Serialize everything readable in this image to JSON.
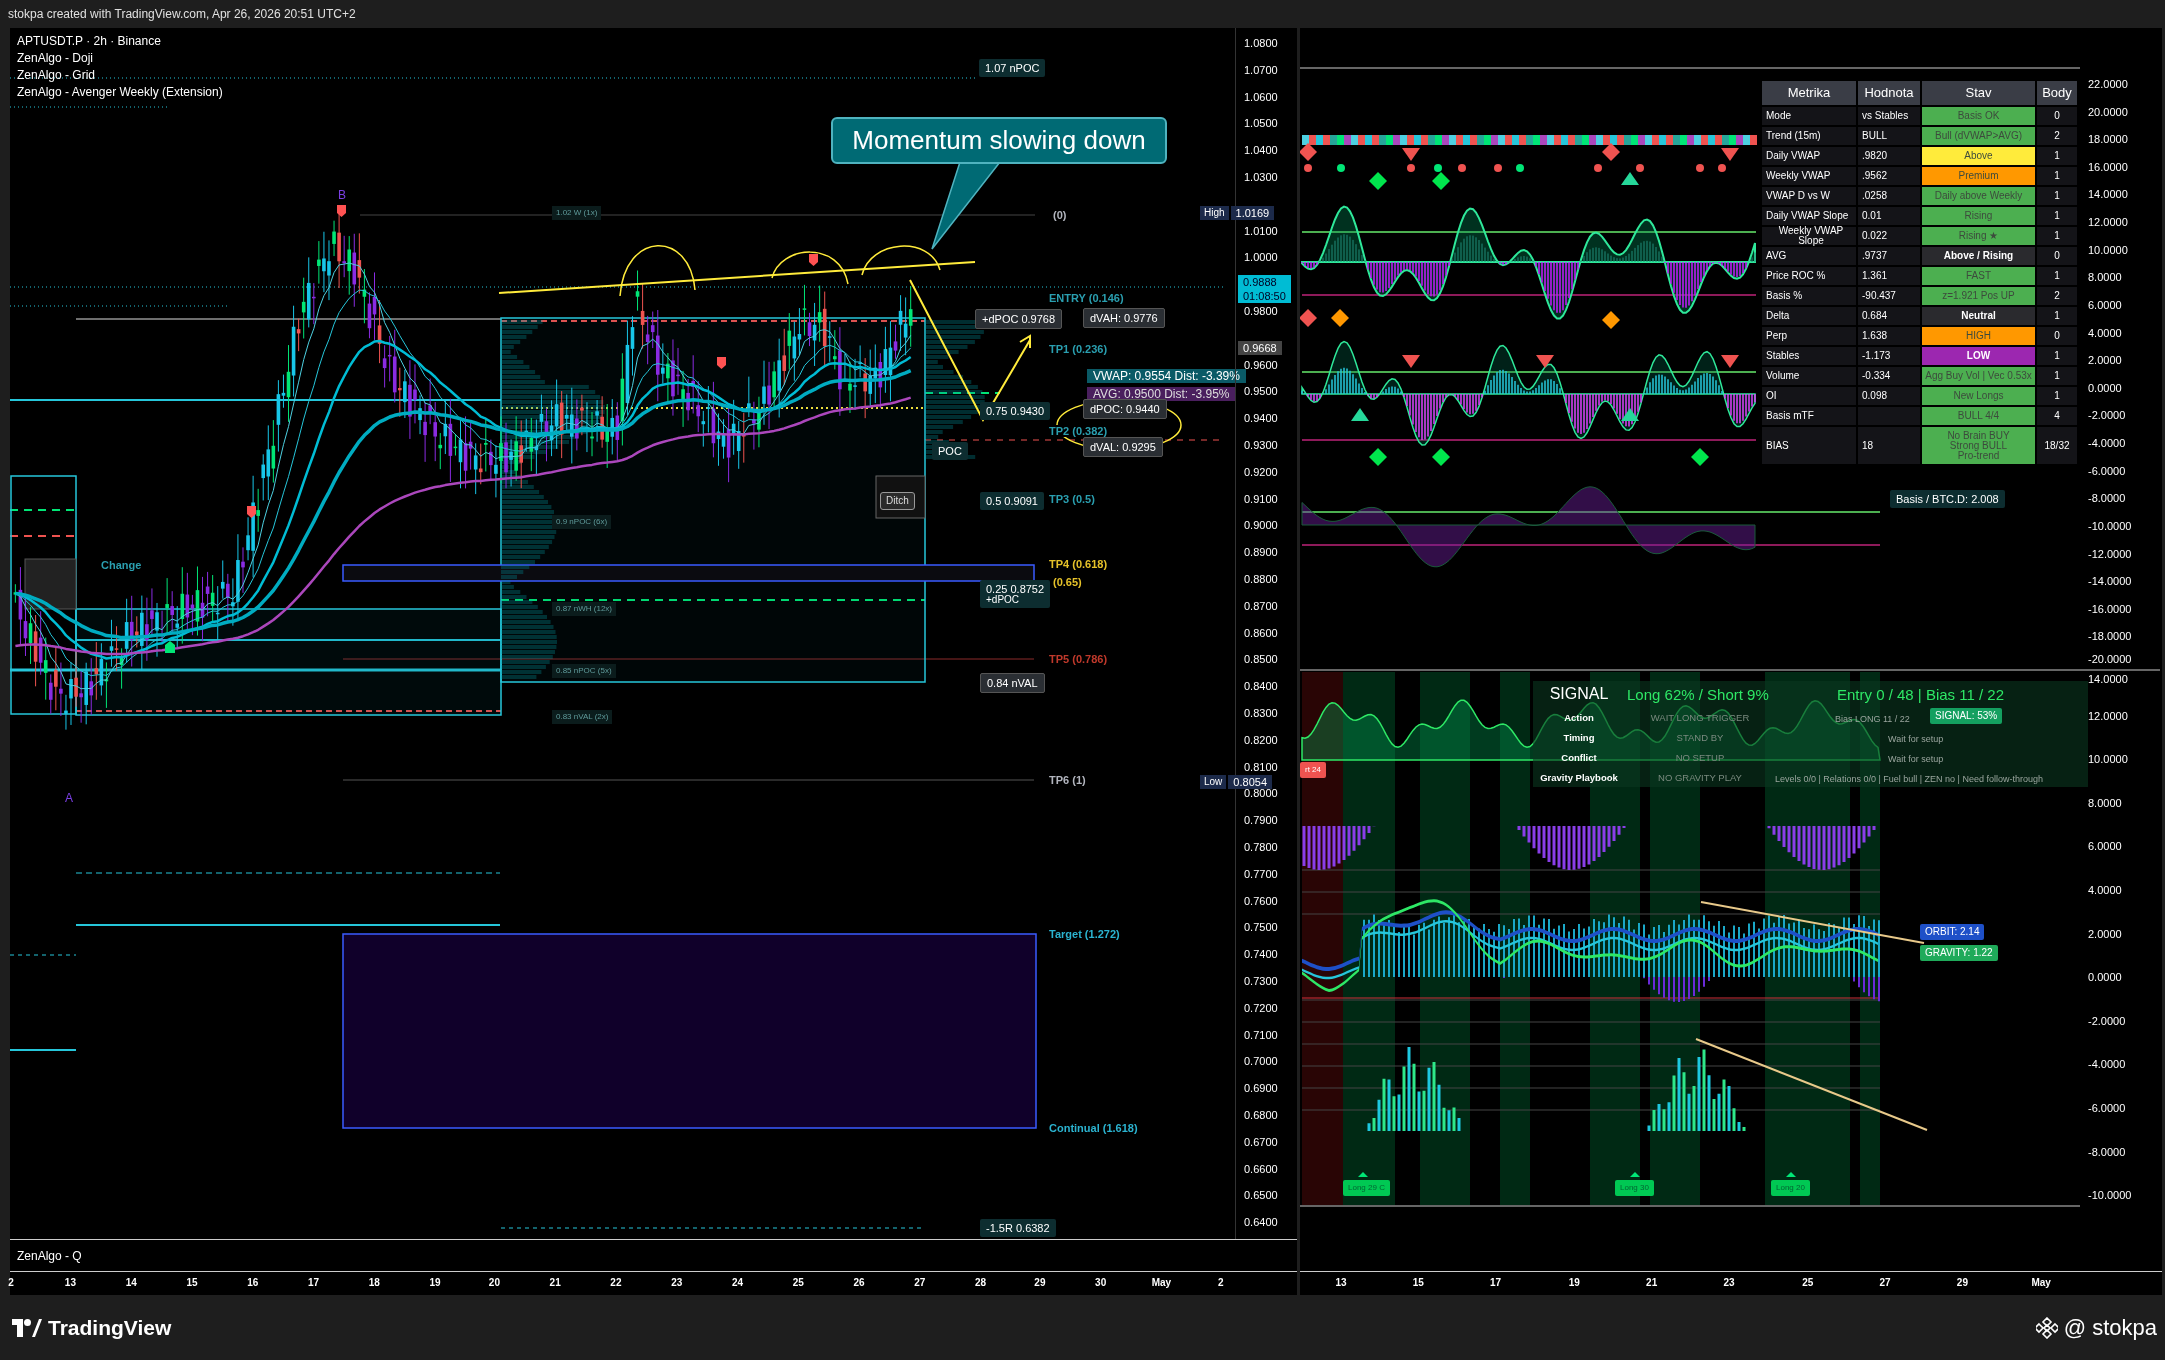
{
  "header": {
    "attribution": "stokpa created with TradingView.com, Apr 26, 2026 20:51 UTC+2"
  },
  "left_chart": {
    "legend": [
      "APTUSDT.P · 2h · Binance",
      "ZenAlgo - Doji",
      "ZenAlgo - Grid",
      "ZenAlgo - Avenger Weekly (Extension)"
    ],
    "callout": "Momentum slowing down",
    "labels": [
      {
        "kind": "tag",
        "text": "1.07 nPOC"
      },
      {
        "kind": "faint",
        "text": "1.02 W (1x)"
      },
      {
        "kind": "marker",
        "text": "B"
      },
      {
        "kind": "marker",
        "text": "A"
      },
      {
        "kind": "level",
        "text": "(0)",
        "color": "#b2b5be"
      },
      {
        "kind": "level",
        "text": "ENTRY (0.146)",
        "color": "#2a9fb0"
      },
      {
        "kind": "box",
        "text": "+dPOC 0.9768"
      },
      {
        "kind": "box",
        "text": "dVAH: 0.9776"
      },
      {
        "kind": "level",
        "text": "TP1 (0.236)",
        "color": "#2a9fb0"
      },
      {
        "kind": "vwap",
        "text": "VWAP: 0.9554  Dist: -3.39%"
      },
      {
        "kind": "avg",
        "text": "AVG: 0.9500  Dist: -3.95%"
      },
      {
        "kind": "tag",
        "text": "0.75  0.9430"
      },
      {
        "kind": "box",
        "text": "dPOC: 0.9440"
      },
      {
        "kind": "level",
        "text": "TP2 (0.382)",
        "color": "#2a9fb0"
      },
      {
        "kind": "box",
        "text": "dVAL: 0.9295"
      },
      {
        "kind": "tag",
        "text": "POC"
      },
      {
        "kind": "button",
        "text": "Ditch"
      },
      {
        "kind": "tag",
        "text": "0.5  0.9091"
      },
      {
        "kind": "level",
        "text": "TP3 (0.5)",
        "color": "#2a9fb0"
      },
      {
        "kind": "level",
        "text": "TP4 (0.618)",
        "color": "#e6c229"
      },
      {
        "kind": "level",
        "text": "(0.65)",
        "color": "#e6c229"
      },
      {
        "kind": "tag",
        "text": "0.25  0.8752",
        "sub": "+dPOC"
      },
      {
        "kind": "level",
        "text": "TP5 (0.786)",
        "color": "#c0392b"
      },
      {
        "kind": "box",
        "text": "0.84 nVAL"
      },
      {
        "kind": "level",
        "text": "Change",
        "color": "#2a9fb0"
      },
      {
        "kind": "level",
        "text": "TP6 (1)",
        "color": "#b2b5be"
      },
      {
        "kind": "level",
        "text": "Target (1.272)",
        "color": "#2bb3d0"
      },
      {
        "kind": "level",
        "text": "Continual (1.618)",
        "color": "#2bb3d0"
      },
      {
        "kind": "tag",
        "text": "-1.5R  0.6382"
      },
      {
        "kind": "faint",
        "text": "0.9 nPOC (6x)"
      },
      {
        "kind": "faint",
        "text": "0.87 nWH (12x)"
      },
      {
        "kind": "faint",
        "text": "0.85 nPOC (5x)"
      },
      {
        "kind": "faint",
        "text": "0.83 nVAL (2x)"
      }
    ],
    "axis_badges": [
      {
        "kind": "extreme",
        "label": "High",
        "value": "1.0169"
      },
      {
        "kind": "last",
        "value": "0.9888",
        "sub": "01:08:50"
      },
      {
        "kind": "mark",
        "value": "0.9668"
      },
      {
        "kind": "extreme",
        "label": "Low",
        "value": "0.8054"
      }
    ],
    "price_ticks": [
      "1.0800",
      "1.0700",
      "1.0600",
      "1.0500",
      "1.0400",
      "1.0300",
      "1.0100",
      "1.0000",
      "0.9800",
      "0.9600",
      "0.9500",
      "0.9400",
      "0.9300",
      "0.9200",
      "0.9100",
      "0.9000",
      "0.8900",
      "0.8800",
      "0.8700",
      "0.8600",
      "0.8500",
      "0.8400",
      "0.8300",
      "0.8200",
      "0.8100",
      "0.8000",
      "0.7900",
      "0.7800",
      "0.7700",
      "0.7600",
      "0.7500",
      "0.7400",
      "0.7300",
      "0.7200",
      "0.7100",
      "0.7000",
      "0.6900",
      "0.6800",
      "0.6700",
      "0.6600",
      "0.6500",
      "0.6400"
    ],
    "lower_pane": {
      "title": "ZenAlgo - Q"
    },
    "date_axis": [
      "2",
      "13",
      "14",
      "15",
      "16",
      "17",
      "18",
      "19",
      "20",
      "21",
      "22",
      "23",
      "24",
      "25",
      "26",
      "27",
      "28",
      "29",
      "30",
      "May",
      "2"
    ]
  },
  "right_chart": {
    "table": {
      "columns": [
        "Metrika",
        "Hodnota",
        "Stav",
        "Body"
      ],
      "rows": [
        {
          "metric": "Mode",
          "value": "vs Stables",
          "status": "Basis OK",
          "color": "#4caf50",
          "points": "0"
        },
        {
          "metric": "Trend (15m)",
          "value": "BULL",
          "status": "Bull (dVWAP>AVG)",
          "color": "#4caf50",
          "points": "2"
        },
        {
          "metric": "Daily VWAP",
          "value": ".9820",
          "status": "Above",
          "color": "#ffeb3b",
          "points": "1"
        },
        {
          "metric": "Weekly VWAP",
          "value": ".9562",
          "status": "Premium",
          "color": "#ff9800",
          "points": "1"
        },
        {
          "metric": "VWAP D vs W",
          "value": ".0258",
          "status": "Daily above Weekly",
          "color": "#4caf50",
          "points": "1"
        },
        {
          "metric": "Daily VWAP Slope",
          "value": "0.01",
          "status": "Rising",
          "color": "#4caf50",
          "points": "1"
        },
        {
          "metric": "Weekly VWAP Slope",
          "value": "0.022",
          "status": "Rising ★",
          "color": "#4caf50",
          "points": "1"
        },
        {
          "metric": "AVG",
          "value": ".9737",
          "status": "Above / Rising",
          "color": "#2a2a2e",
          "points": "0"
        },
        {
          "metric": "Price ROC %",
          "value": "1.361",
          "status": "FAST",
          "color": "#4caf50",
          "points": "1"
        },
        {
          "metric": "Basis %",
          "value": "-90.437",
          "status": "z=1.921 Pos UP",
          "color": "#4caf50",
          "points": "2"
        },
        {
          "metric": "Delta",
          "value": "0.684",
          "status": "Neutral",
          "color": "#2a2a2e",
          "points": "1"
        },
        {
          "metric": "Perp",
          "value": "1.638",
          "status": "HIGH",
          "color": "#ff9800",
          "points": "0"
        },
        {
          "metric": "Stables",
          "value": "-1.173",
          "status": "LOW",
          "color": "#9c27b0",
          "points": "1"
        },
        {
          "metric": "Volume",
          "value": "-0.334",
          "status": "Agg Buy Vol | Vec 0.53x",
          "color": "#4caf50",
          "points": "1"
        },
        {
          "metric": "OI",
          "value": "0.098",
          "status": "New Longs",
          "color": "#4caf50",
          "points": "1"
        },
        {
          "metric": "Basis mTF",
          "status": "BULL 4/4",
          "color": "#4caf50",
          "points": "4"
        },
        {
          "metric": "BIAS",
          "value": "18",
          "status": "No Brain BUY\nStrong BULL\nPro-trend",
          "color": "#4caf50",
          "points": "18/32"
        }
      ]
    },
    "labels": [
      {
        "kind": "tag",
        "text": "Basis / BTC.D: 2.008"
      }
    ],
    "price_ticks": [
      "22.0000",
      "20.0000",
      "18.0000",
      "16.0000",
      "14.0000",
      "12.0000",
      "10.0000",
      "8.0000",
      "6.0000",
      "4.0000",
      "2.0000",
      "0.0000",
      "-2.0000",
      "-4.0000",
      "-6.0000",
      "-8.0000",
      "-10.0000",
      "-12.0000",
      "-14.0000",
      "-16.0000",
      "-18.0000",
      "-20.0000"
    ]
  },
  "signal_pane": {
    "header": [
      "SIGNAL",
      "Long 62% / Short 9%",
      "Entry 0 / 48 | Bias 11 / 22"
    ],
    "rows": [
      {
        "label": "Action",
        "state": "WAIT LONG TRIGGER",
        "note": "Bias LONG 11 / 22"
      },
      {
        "label": "Timing",
        "state": "STAND BY",
        "note": "Wait for setup"
      },
      {
        "label": "Conflict",
        "state": "NO SETUP",
        "note": "Wait for setup"
      },
      {
        "label": "Gravity Playbook",
        "state": "NO GRAVITY PLAY",
        "note": "Levels 0/0 | Relations 0/0 | Fuel bull | ZEN no | Need follow-through"
      }
    ],
    "tags": [
      {
        "kind": "signal",
        "text": "SIGNAL: 53%"
      },
      {
        "kind": "short",
        "text": "rt 24"
      },
      {
        "kind": "orbit",
        "text": "ORBIT: 2.14"
      },
      {
        "kind": "gravity",
        "text": "GRAVITY: 1.22"
      },
      {
        "kind": "long",
        "text": "Long 29 C"
      },
      {
        "kind": "long",
        "text": "Long 30"
      },
      {
        "kind": "long",
        "text": "Long 20"
      }
    ],
    "price_ticks": [
      "14.0000",
      "12.0000",
      "10.0000",
      "8.0000",
      "6.0000",
      "4.0000",
      "2.0000",
      "0.0000",
      "-2.0000",
      "-4.0000",
      "-6.0000",
      "-8.0000",
      "-10.0000"
    ],
    "date_axis": [
      "13",
      "15",
      "17",
      "19",
      "21",
      "23",
      "25",
      "27",
      "29",
      "May"
    ]
  },
  "footer": {
    "brand": "TradingView",
    "user": "@ stokpa"
  }
}
